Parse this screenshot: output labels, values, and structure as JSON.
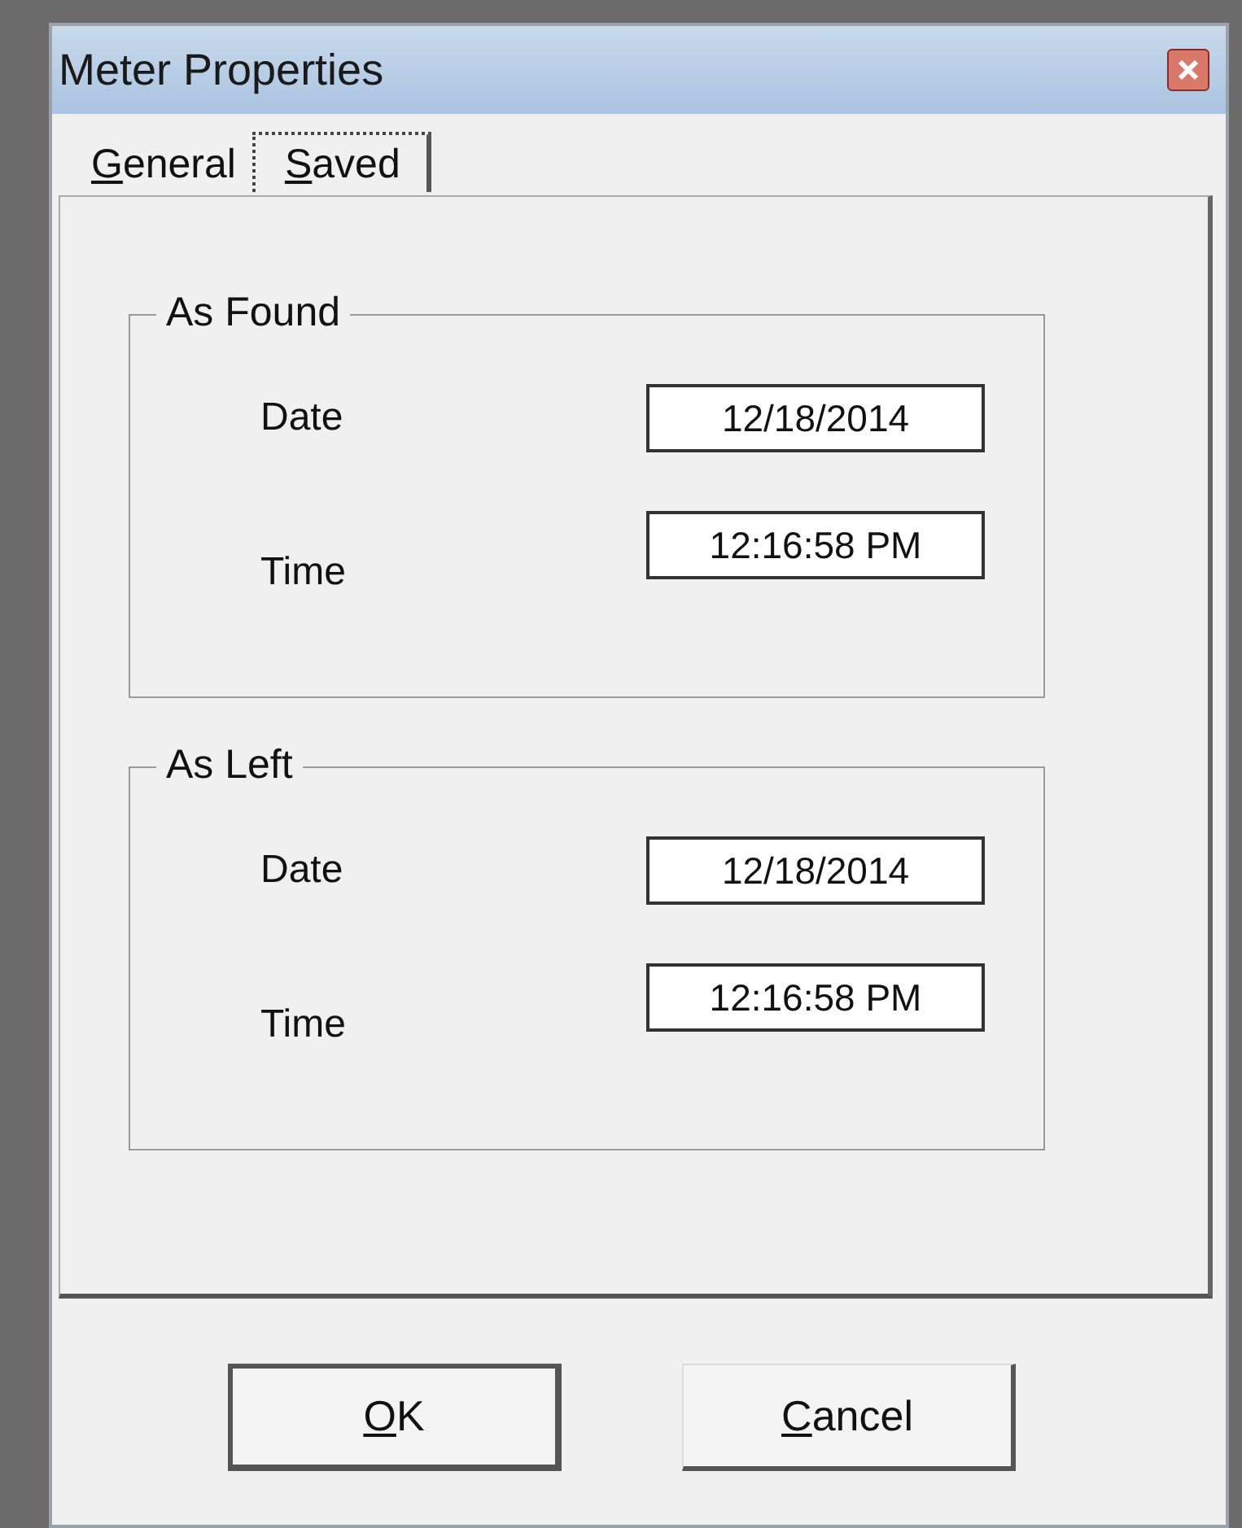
{
  "window": {
    "title": "Meter Properties"
  },
  "tabs": [
    {
      "label": "General",
      "selected": false
    },
    {
      "label": "Saved",
      "selected": true
    }
  ],
  "groups": [
    {
      "title": "As Found",
      "fields": [
        {
          "label": "Date",
          "value": "12/18/2014"
        },
        {
          "label": "Time",
          "value": "12:16:58 PM"
        }
      ]
    },
    {
      "title": "As Left",
      "fields": [
        {
          "label": "Date",
          "value": "12/18/2014"
        },
        {
          "label": "Time",
          "value": "12:16:58 PM"
        }
      ]
    }
  ],
  "buttons": [
    {
      "label": "OK",
      "default": true
    },
    {
      "label": "Cancel",
      "default": false
    }
  ]
}
